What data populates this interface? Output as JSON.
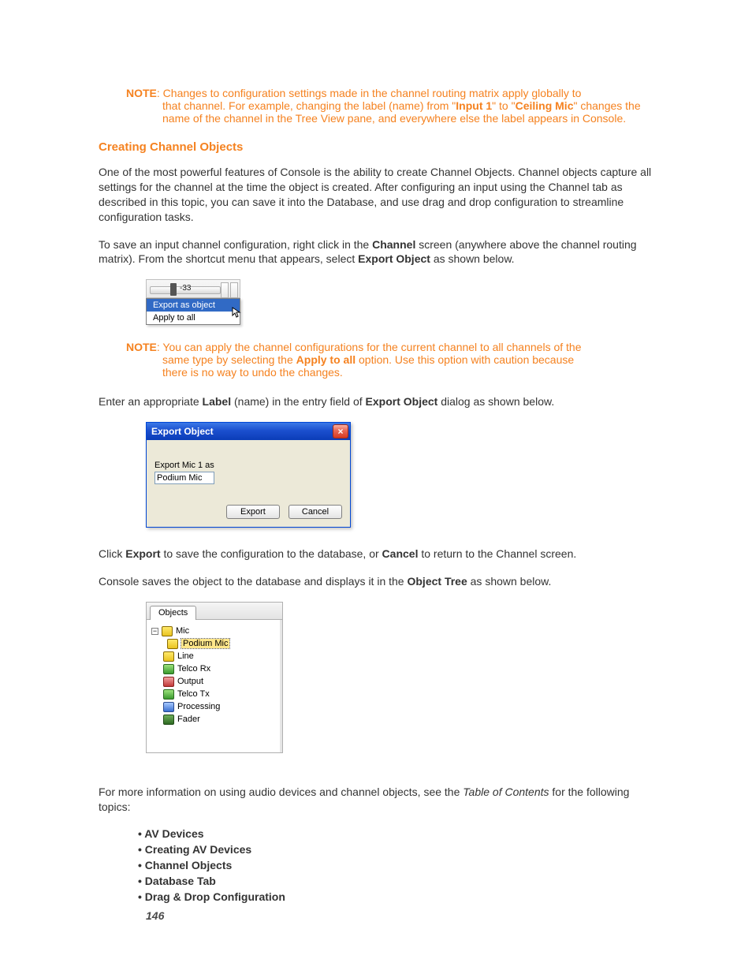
{
  "note1": {
    "prefix": "NOTE",
    "text_line1": ": Changes to configuration settings made in the channel routing matrix apply globally to",
    "rest": "that channel. For example, changing the label (name) from \"",
    "input1": "Input 1",
    "mid": "\" to \"",
    "ceiling": "Ceiling Mic",
    "tail": "\" changes the name of the channel in the Tree View pane, and everywhere else the label appears in Console."
  },
  "section_heading": "Creating Channel Objects",
  "para1": "One of the most powerful features of Console is the ability to create Channel Objects. Channel objects capture all settings for the channel at the time the object is created. After configuring an input using the Channel tab as described in this topic, you can save it into the Database, and use drag and drop configuration to streamline configuration tasks.",
  "para2_a": "To save an input channel configuration, right click in the ",
  "para2_channel": "Channel",
  "para2_b": " screen (anywhere above the channel routing matrix). From the shortcut menu that appears, select ",
  "para2_export": "Export Object",
  "para2_c": " as shown below.",
  "context_menu": {
    "value": "-33",
    "item_export": "Export as object",
    "item_apply": "Apply to all"
  },
  "note2": {
    "prefix": "NOTE",
    "line1": ": You can apply the channel configurations for the current channel to all channels of the",
    "line2a": "same type by selecting the ",
    "apply": "Apply to all",
    "line2b": " option. Use this option with caution because",
    "line3": "there is no way to undo the changes."
  },
  "para3_a": "Enter an appropriate ",
  "para3_label": "Label",
  "para3_b": " (name) in the entry field of ",
  "para3_export": "Export Object",
  "para3_c": " dialog as shown below.",
  "dialog": {
    "title": "Export Object",
    "prompt": "Export Mic 1 as",
    "value": "Podium Mic",
    "btn_export": "Export",
    "btn_cancel": "Cancel"
  },
  "para4_a": "Click ",
  "para4_export": "Export",
  "para4_b": " to save the configuration to the database, or ",
  "para4_cancel": "Cancel",
  "para4_c": " to return to the Channel screen.",
  "para5_a": "Console saves the object to the database and displays it in the ",
  "para5_tree": "Object Tree",
  "para5_b": " as shown below.",
  "tree": {
    "tab": "Objects",
    "nodes": {
      "mic": "Mic",
      "podium": "Podium Mic",
      "line": "Line",
      "telco_rx": "Telco Rx",
      "output": "Output",
      "telco_tx": "Telco Tx",
      "processing": "Processing",
      "fader": "Fader"
    }
  },
  "para6_a": "For more information on using audio devices and channel objects, see the ",
  "para6_toc": "Table of Contents",
  "para6_b": " for the following topics:",
  "topics": {
    "t1": "AV Devices",
    "t2": "Creating AV Devices",
    "t3": "Channel Objects",
    "t4": "Database Tab",
    "t5": "Drag & Drop Configuration"
  },
  "page_number": "146"
}
